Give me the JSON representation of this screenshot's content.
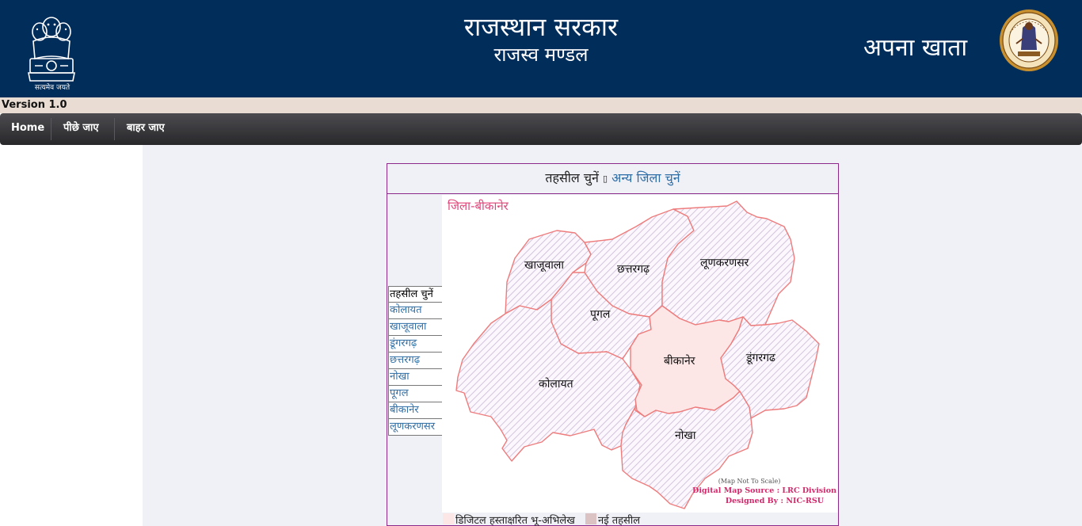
{
  "header": {
    "emblem_caption": "सत्यमेव जयते",
    "title_main": "राजस्थान सरकार",
    "title_sub": "राजस्व मण्डल",
    "brand_right": "अपना खाता"
  },
  "version": "Version 1.0",
  "nav": {
    "home": "Home",
    "back": "पीछे जाए",
    "exit": "बाहर जाए"
  },
  "selector": {
    "tehsil_prompt": "तहसील चुनें",
    "other_district_link": "अन्य जिला चुनें"
  },
  "tehsil_list": {
    "header": "तहसील चुनें",
    "items": [
      "कोलायत",
      "खाजूवाला",
      "डूंगरगढ़",
      "छत्तरगढ़",
      "नोखा",
      "पूगल",
      "बीकानेर",
      "लूणकरणसर"
    ]
  },
  "map": {
    "district_title": "जिला-बीकानेर",
    "labels": {
      "khajuwala": "खाजूवाला",
      "chhattargarh": "छत्तरगढ़",
      "lunkaransar": "लूणकरणसर",
      "poogal": "पूगल",
      "bikaner": "बीकानेर",
      "dungargarh": "डूंगरगढ",
      "kolayat": "कोलायत",
      "nokha": "नोखा"
    },
    "not_to_scale": "(Map Not To Scale)",
    "source_credit": "Digital Map Source : LRC Division",
    "designed_by": "Designed By : NIC-RSU",
    "colors": {
      "border": "#ee7c7c",
      "digital_fill": "#fde6e6",
      "hatch": "#c9b8d6",
      "new_tehsil_swatch": "#dcc3c3"
    }
  },
  "legend": {
    "digital_signed": "डिजिटल हस्ताक्षरित भू-अभिलेख",
    "new_tehsil": "नई तहसील"
  },
  "colors": {
    "header_bg": "#012d5b",
    "version_bar_bg": "#e9ddd3",
    "nav_bg": "#333336",
    "link": "#2f6ea6"
  }
}
